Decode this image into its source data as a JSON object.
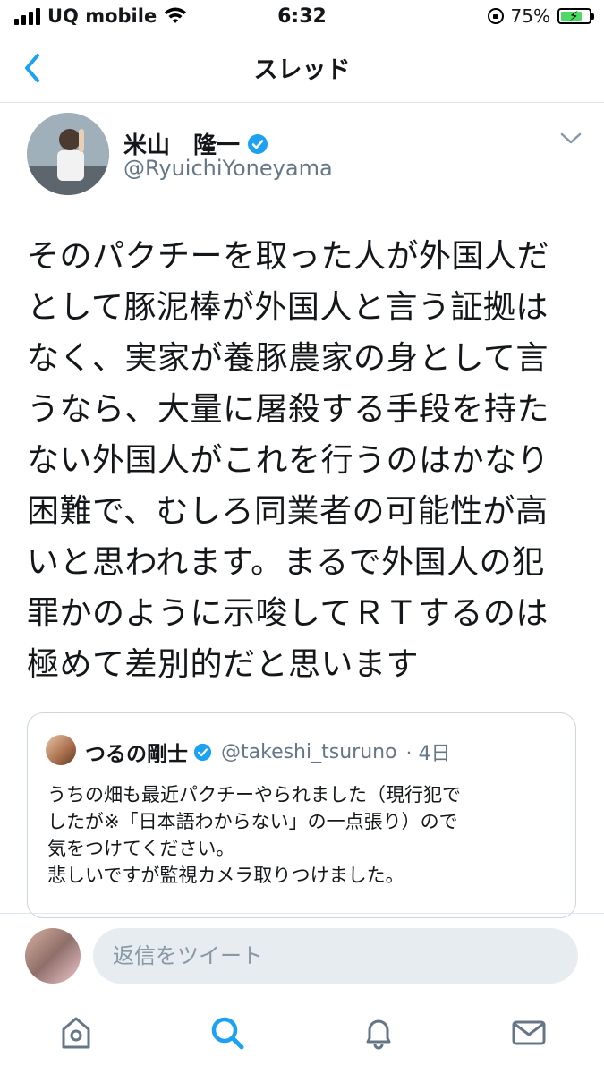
{
  "status_bar": {
    "carrier": "UQ mobile",
    "time": "6:32",
    "battery": "75%",
    "battery_level": 0.75
  },
  "nav": {
    "title": "スレッド",
    "back_icon": "chevron-left-icon"
  },
  "tweet": {
    "name": "米山　隆一",
    "handle": "@RyuichiYoneyama",
    "text": "そのパクチーを取った人が外国人だ\nとして豚泥棒が外国人と言う証拠は\nなく、実家が養豚農家の身として言\nうなら、大量に屠殺する手段を持た\nない外国人がこれを行うのはかなり\n困難で、むしろ同業者の可能性が高\nいと思われます。まるで外国人の犯\n罪かのように示唆してＲＴするのは\n極めて差別的だと思います"
  },
  "quote": {
    "name": "つるの剛士",
    "handle": "@takeshi_tsuruno",
    "time": "· 4日",
    "text": "うちの畑も最近パクチーやられました（現行犯で\nしたが※「日本語わからない」の一点張り）ので\n気をつけてください。\n悲しいですが監視カメラ取りつけました。"
  },
  "reply": {
    "placeholder": "返信をツイート"
  },
  "colors": {
    "accent": "#1da1f2",
    "text": "#14171a",
    "muted": "#657786"
  },
  "tabs": [
    "home-icon",
    "search-icon",
    "notifications-icon",
    "messages-icon"
  ]
}
